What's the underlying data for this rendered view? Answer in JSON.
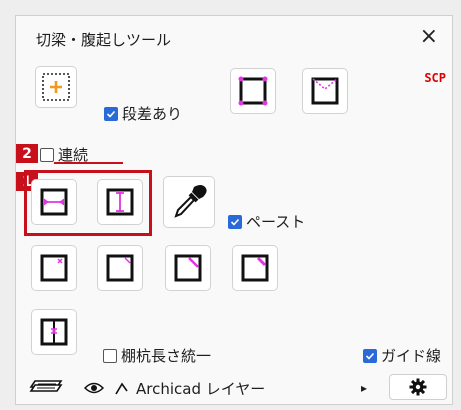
{
  "window": {
    "title": "切梁・腹起しツール",
    "close_glyph": "×"
  },
  "scp_label": "SCP",
  "checkboxes": {
    "step": {
      "label": "段差あり",
      "checked": true
    },
    "continuous": {
      "label": "連続",
      "checked": false
    },
    "paste": {
      "label": "ペースト",
      "checked": true
    },
    "unify_length": {
      "label": "棚杭長さ統一",
      "checked": false
    },
    "guide_line": {
      "label": "ガイド線",
      "checked": true
    }
  },
  "badges": {
    "one": "1",
    "two": "2"
  },
  "layer": {
    "name": "Archicad レイヤー",
    "arrow": "▸"
  },
  "icons": [
    "add-selection-icon",
    "corner-square-icon",
    "corner-dashed-icon",
    "horizontal-strut-icon",
    "vertical-strut-icon",
    "eyedropper-icon",
    "corner-x-icon",
    "corner-diag-small-icon",
    "corner-diag-icon",
    "corner-diag-right-icon",
    "post-strut-icon",
    "layers-icon",
    "eye-icon",
    "lock-open-icon",
    "gear-icon"
  ],
  "colors": {
    "accent_magenta": "#e234e2",
    "checkbox_blue": "#2a6ad8",
    "badge_red": "#c8101d",
    "scp_red": "#e00000"
  }
}
